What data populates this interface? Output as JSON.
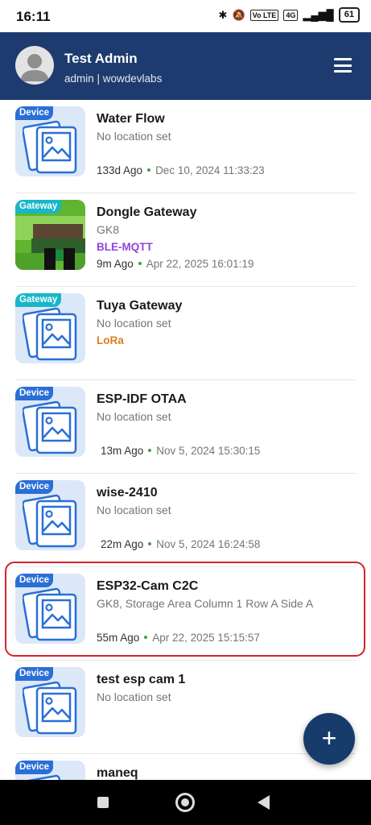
{
  "status": {
    "time": "16:11",
    "vo_label": "Vo LTE",
    "net_label": "4G",
    "battery": "61"
  },
  "header": {
    "user_name": "Test  Admin",
    "subtitle": "admin | wowdevlabs"
  },
  "colors": {
    "header": "#1d3b6e",
    "device_badge": "#2a6fd6",
    "gateway_badge": "#17b6c9",
    "ble": "#8e44e0",
    "lora": "#e07b22",
    "online_dot": "#43a047",
    "highlight": "#d6222a"
  },
  "items": [
    {
      "badge": "Device",
      "title": "Water Flow",
      "location": "No location set",
      "protocol": "",
      "ago": "133d Ago",
      "date": "Dec 10, 2024 11:33:23"
    },
    {
      "badge": "Gateway",
      "title": "Dongle Gateway",
      "location": "GK8",
      "protocol": "BLE-MQTT",
      "ago": "9m Ago",
      "date": "Apr 22, 2025 16:01:19"
    },
    {
      "badge": "Gateway",
      "title": "Tuya Gateway",
      "location": "No location set",
      "protocol": "LoRa",
      "ago": "",
      "date": ""
    },
    {
      "badge": "Device",
      "title": "ESP-IDF OTAA",
      "location": "No location set",
      "protocol": "",
      "ago": "13m Ago",
      "date": "Nov 5, 2024 15:30:15"
    },
    {
      "badge": "Device",
      "title": "wise-2410",
      "location": "No location set",
      "protocol": "",
      "ago": "22m Ago",
      "date": "Nov 5, 2024 16:24:58"
    },
    {
      "badge": "Device",
      "title": "ESP32-Cam C2C",
      "location": "GK8, Storage Area Column 1 Row A Side A",
      "protocol": "",
      "ago": "55m Ago",
      "date": "Apr 22, 2025 15:15:57"
    },
    {
      "badge": "Device",
      "title": "test esp cam 1",
      "location": "No location set",
      "protocol": "",
      "ago": "",
      "date": ""
    },
    {
      "badge": "Device",
      "title": "maneq",
      "location": "",
      "protocol": "",
      "ago": "",
      "date": ""
    }
  ],
  "fab": {
    "label": "+",
    "icon": "plus-icon"
  },
  "nav": {
    "recents": "square-icon",
    "home": "circle-icon",
    "back": "triangle-back-icon"
  }
}
